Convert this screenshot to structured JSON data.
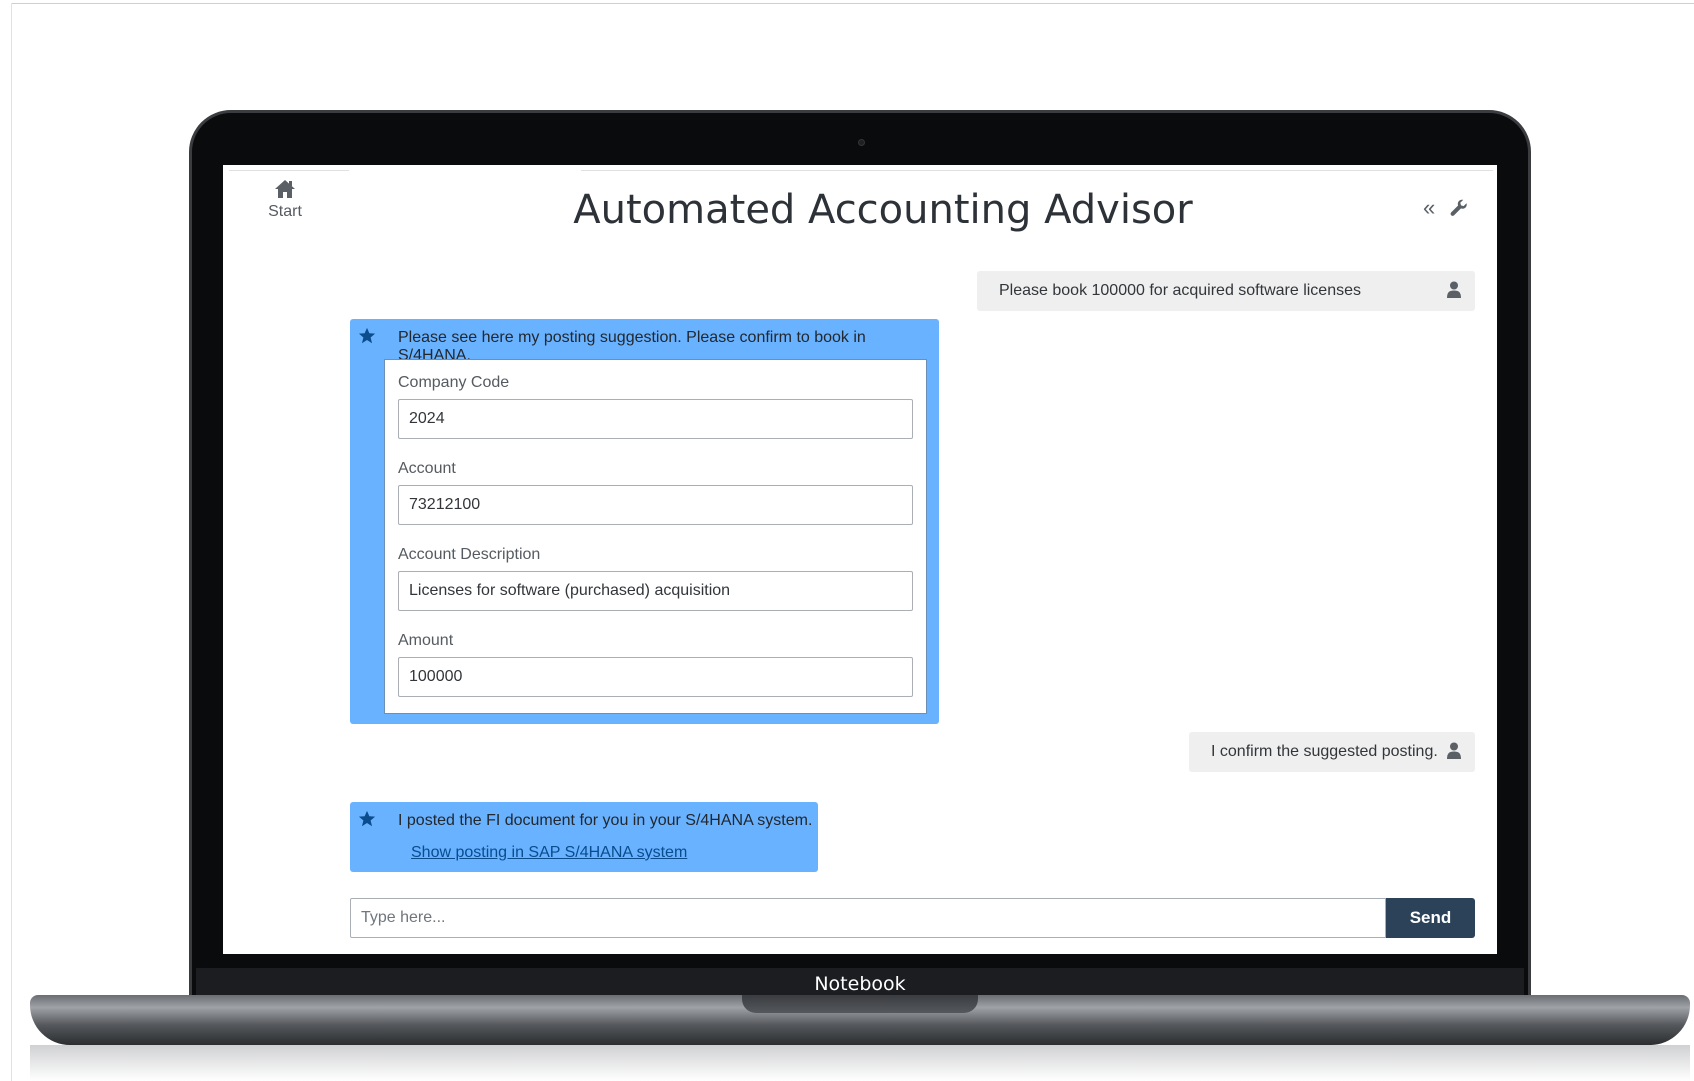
{
  "app": {
    "title": "Automated Accounting Advisor",
    "start_label": "Start",
    "device_label": "Notebook"
  },
  "chat": {
    "messages": [
      {
        "role": "user",
        "text": "Please book 100000 for acquired software licenses"
      },
      {
        "role": "bot",
        "text": "Please see here my posting suggestion. Please confirm to book in S/4HANA."
      },
      {
        "role": "user",
        "text": "I confirm the suggested posting."
      },
      {
        "role": "bot",
        "text": "I posted the FI document for you in your S/4HANA system.",
        "link_text": "Show posting in SAP S/4HANA system"
      }
    ],
    "form": {
      "fields": [
        {
          "label": "Company Code",
          "value": "2024"
        },
        {
          "label": "Account",
          "value": "73212100"
        },
        {
          "label": "Account Description",
          "value": "Licenses for software (purchased) acquisition"
        },
        {
          "label": "Amount",
          "value": "100000"
        }
      ]
    },
    "input": {
      "placeholder": "Type here...",
      "value": ""
    },
    "send_label": "Send"
  },
  "icons": {
    "home": "home-icon",
    "collapse": "double-chevron-left-icon",
    "settings": "wrench-icon",
    "user": "person-icon",
    "bot": "star-icon"
  },
  "colors": {
    "bot_bubble": "#69b2ff",
    "user_bubble": "#efefef",
    "send_button": "#2c4259",
    "link": "#0a4c8c"
  }
}
